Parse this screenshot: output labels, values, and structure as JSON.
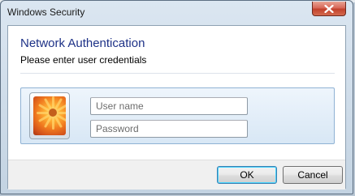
{
  "window": {
    "title": "Windows Security",
    "close_icon": "close-icon"
  },
  "dialog": {
    "heading": "Network Authentication",
    "subheading": "Please enter user credentials"
  },
  "credentials": {
    "avatar_icon": "user-tile-flower-icon",
    "username_placeholder": "User name",
    "password_placeholder": "Password"
  },
  "buttons": {
    "ok_label": "OK",
    "cancel_label": "Cancel"
  },
  "colors": {
    "heading": "#1e3287",
    "close_button": "#c2412c",
    "default_button_border": "#3c7fb1"
  }
}
